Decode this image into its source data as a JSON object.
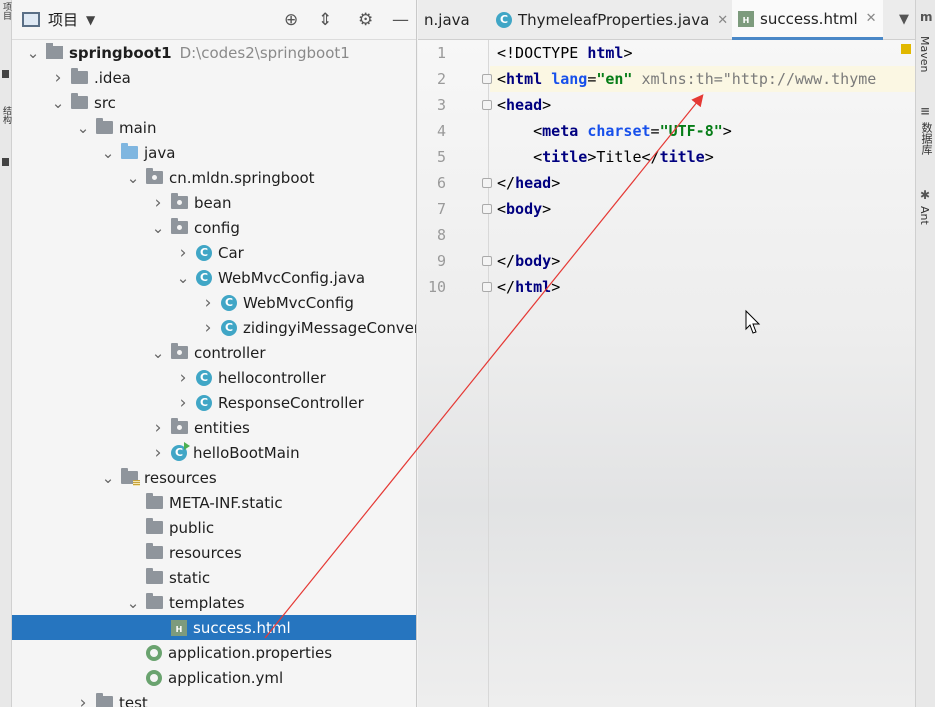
{
  "left_strip": {
    "label_top": "项目",
    "label_mid": "结构"
  },
  "project": {
    "title": "项目",
    "tree": [
      {
        "label": "springboot1",
        "hint": "D:\\codes2\\springboot1",
        "icon": "project-folder-icon",
        "arrow": "down",
        "bold": true
      },
      {
        "label": ".idea",
        "icon": "folder-icon",
        "arrow": "right"
      },
      {
        "label": "src",
        "icon": "folder-icon",
        "arrow": "down"
      },
      {
        "label": "main",
        "icon": "folder-icon",
        "arrow": "down"
      },
      {
        "label": "java",
        "icon": "source-folder-icon",
        "arrow": "down"
      },
      {
        "label": "cn.mldn.springboot",
        "icon": "package-icon",
        "arrow": "down"
      },
      {
        "label": "bean",
        "icon": "package-icon",
        "arrow": "right"
      },
      {
        "label": "config",
        "icon": "package-icon",
        "arrow": "down"
      },
      {
        "label": "Car",
        "icon": "class-icon",
        "arrow": "right"
      },
      {
        "label": "WebMvcConfig.java",
        "icon": "class-icon",
        "arrow": "down"
      },
      {
        "label": "WebMvcConfig",
        "icon": "class-icon",
        "arrow": "right"
      },
      {
        "label": "zidingyiMessageConvert",
        "icon": "class-icon",
        "arrow": "right"
      },
      {
        "label": "controller",
        "icon": "package-icon",
        "arrow": "down"
      },
      {
        "label": "hellocontroller",
        "icon": "class-icon",
        "arrow": "right"
      },
      {
        "label": "ResponseController",
        "icon": "class-icon",
        "arrow": "right"
      },
      {
        "label": "entities",
        "icon": "package-icon",
        "arrow": "right"
      },
      {
        "label": "helloBootMain",
        "icon": "main-class-icon",
        "arrow": "right"
      },
      {
        "label": "resources",
        "icon": "resources-folder-icon",
        "arrow": "down"
      },
      {
        "label": "META-INF.static",
        "icon": "folder-icon",
        "arrow": "none"
      },
      {
        "label": "public",
        "icon": "folder-icon",
        "arrow": "none"
      },
      {
        "label": "resources",
        "icon": "folder-icon",
        "arrow": "none"
      },
      {
        "label": "static",
        "icon": "folder-icon",
        "arrow": "none"
      },
      {
        "label": "templates",
        "icon": "folder-icon",
        "arrow": "down"
      },
      {
        "label": "success.html",
        "icon": "html-file-icon",
        "arrow": "none",
        "selected": true
      },
      {
        "label": "application.properties",
        "icon": "spring-config-icon",
        "arrow": "none"
      },
      {
        "label": "application.yml",
        "icon": "spring-config-icon",
        "arrow": "none"
      },
      {
        "label": "test",
        "icon": "folder-icon",
        "arrow": "right"
      }
    ]
  },
  "tabs": [
    {
      "label": "n.java",
      "icon": "none",
      "active": false,
      "closable": false
    },
    {
      "label": "ThymeleafProperties.java",
      "icon": "class-icon",
      "active": false,
      "closable": true
    },
    {
      "label": "success.html",
      "icon": "html-file-icon",
      "active": true,
      "closable": true
    }
  ],
  "editor": {
    "line_numbers": [
      "1",
      "2",
      "3",
      "4",
      "5",
      "6",
      "7",
      "8",
      "9",
      "10"
    ],
    "lines": [
      [
        {
          "t": "plain",
          "v": "<!DOCTYPE "
        },
        {
          "t": "tag",
          "v": "html"
        },
        {
          "t": "plain",
          "v": ">"
        }
      ],
      [
        {
          "t": "plain",
          "v": "<"
        },
        {
          "t": "tag",
          "v": "html "
        },
        {
          "t": "attr",
          "v": "lang"
        },
        {
          "t": "plain",
          "v": "="
        },
        {
          "t": "val",
          "v": "\"en\""
        },
        {
          "t": "dim",
          "v": " xmlns:th=\"http://www.thyme"
        }
      ],
      [
        {
          "t": "plain",
          "v": "<"
        },
        {
          "t": "tag",
          "v": "head"
        },
        {
          "t": "plain",
          "v": ">"
        }
      ],
      [
        {
          "t": "plain",
          "v": "    <"
        },
        {
          "t": "tag",
          "v": "meta "
        },
        {
          "t": "attr",
          "v": "charset"
        },
        {
          "t": "plain",
          "v": "="
        },
        {
          "t": "val",
          "v": "\"UTF-8\""
        },
        {
          "t": "plain",
          "v": ">"
        }
      ],
      [
        {
          "t": "plain",
          "v": "    <"
        },
        {
          "t": "tag",
          "v": "title"
        },
        {
          "t": "plain",
          "v": ">Title</"
        },
        {
          "t": "tag",
          "v": "title"
        },
        {
          "t": "plain",
          "v": ">"
        }
      ],
      [
        {
          "t": "plain",
          "v": "</"
        },
        {
          "t": "tag",
          "v": "head"
        },
        {
          "t": "plain",
          "v": ">"
        }
      ],
      [
        {
          "t": "plain",
          "v": "<"
        },
        {
          "t": "tag",
          "v": "body"
        },
        {
          "t": "plain",
          "v": ">"
        }
      ],
      [],
      [
        {
          "t": "plain",
          "v": "</"
        },
        {
          "t": "tag",
          "v": "body"
        },
        {
          "t": "plain",
          "v": ">"
        }
      ],
      [
        {
          "t": "plain",
          "v": "</"
        },
        {
          "t": "tag",
          "v": "html"
        },
        {
          "t": "plain",
          "v": ">"
        }
      ]
    ]
  },
  "right_strip": {
    "maven": "Maven",
    "database": "数据库",
    "ant": "Ant"
  },
  "colors": {
    "selection": "#2675bf",
    "annotation_arrow": "#e53935"
  }
}
